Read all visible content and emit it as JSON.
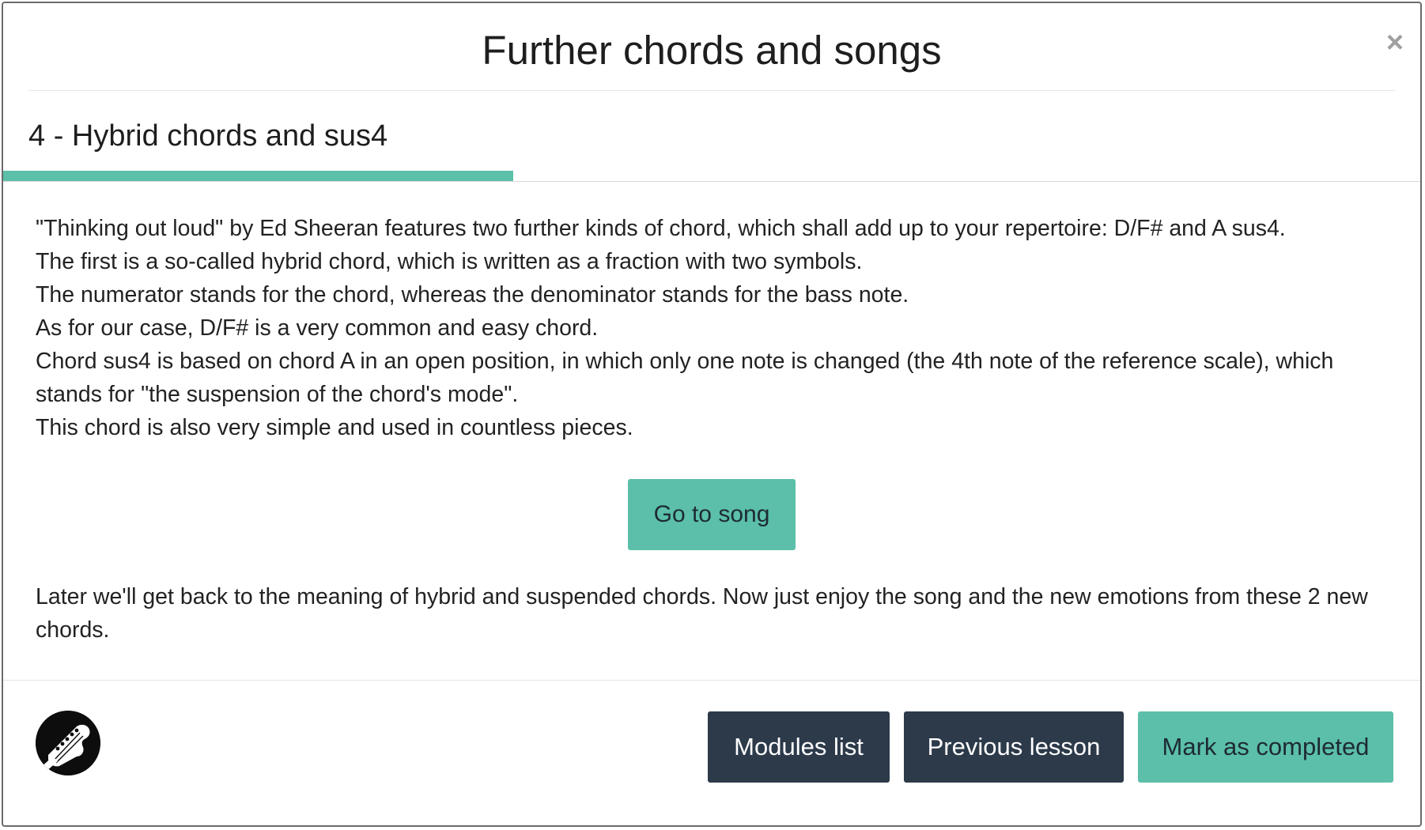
{
  "modal": {
    "title": "Further chords and songs",
    "close_label": "×"
  },
  "lesson": {
    "title": "4 - Hybrid chords and sus4",
    "progress_fraction": 0.36,
    "paragraphs": [
      "\"Thinking out loud\" by Ed Sheeran features two further kinds of chord, which shall add up to your repertoire: D/F# and A sus4.",
      "The first is a so-called hybrid chord, which is written as a fraction with two symbols.",
      "The numerator stands for the chord, whereas the denominator stands for the bass note.",
      "As for our case, D/F# is a very common and easy chord.",
      "Chord sus4 is based on chord A in an open position, in which only one note is changed (the 4th note of the reference scale), which stands for \"the suspension of the chord's mode\".",
      "This chord is also very simple and used in countless pieces."
    ],
    "song_button_label": "Go to song",
    "closing_paragraph": "Later we'll get back to the meaning of hybrid and suspended chords. Now just enjoy the song and the new emotions from these 2 new chords."
  },
  "footer": {
    "logo_icon": "guitar-headstock-icon",
    "modules_label": "Modules list",
    "previous_label": "Previous lesson",
    "complete_label": "Mark as completed"
  },
  "colors": {
    "accent": "#5bbfa9",
    "dark_button": "#2c3a4a",
    "text": "#222222"
  }
}
